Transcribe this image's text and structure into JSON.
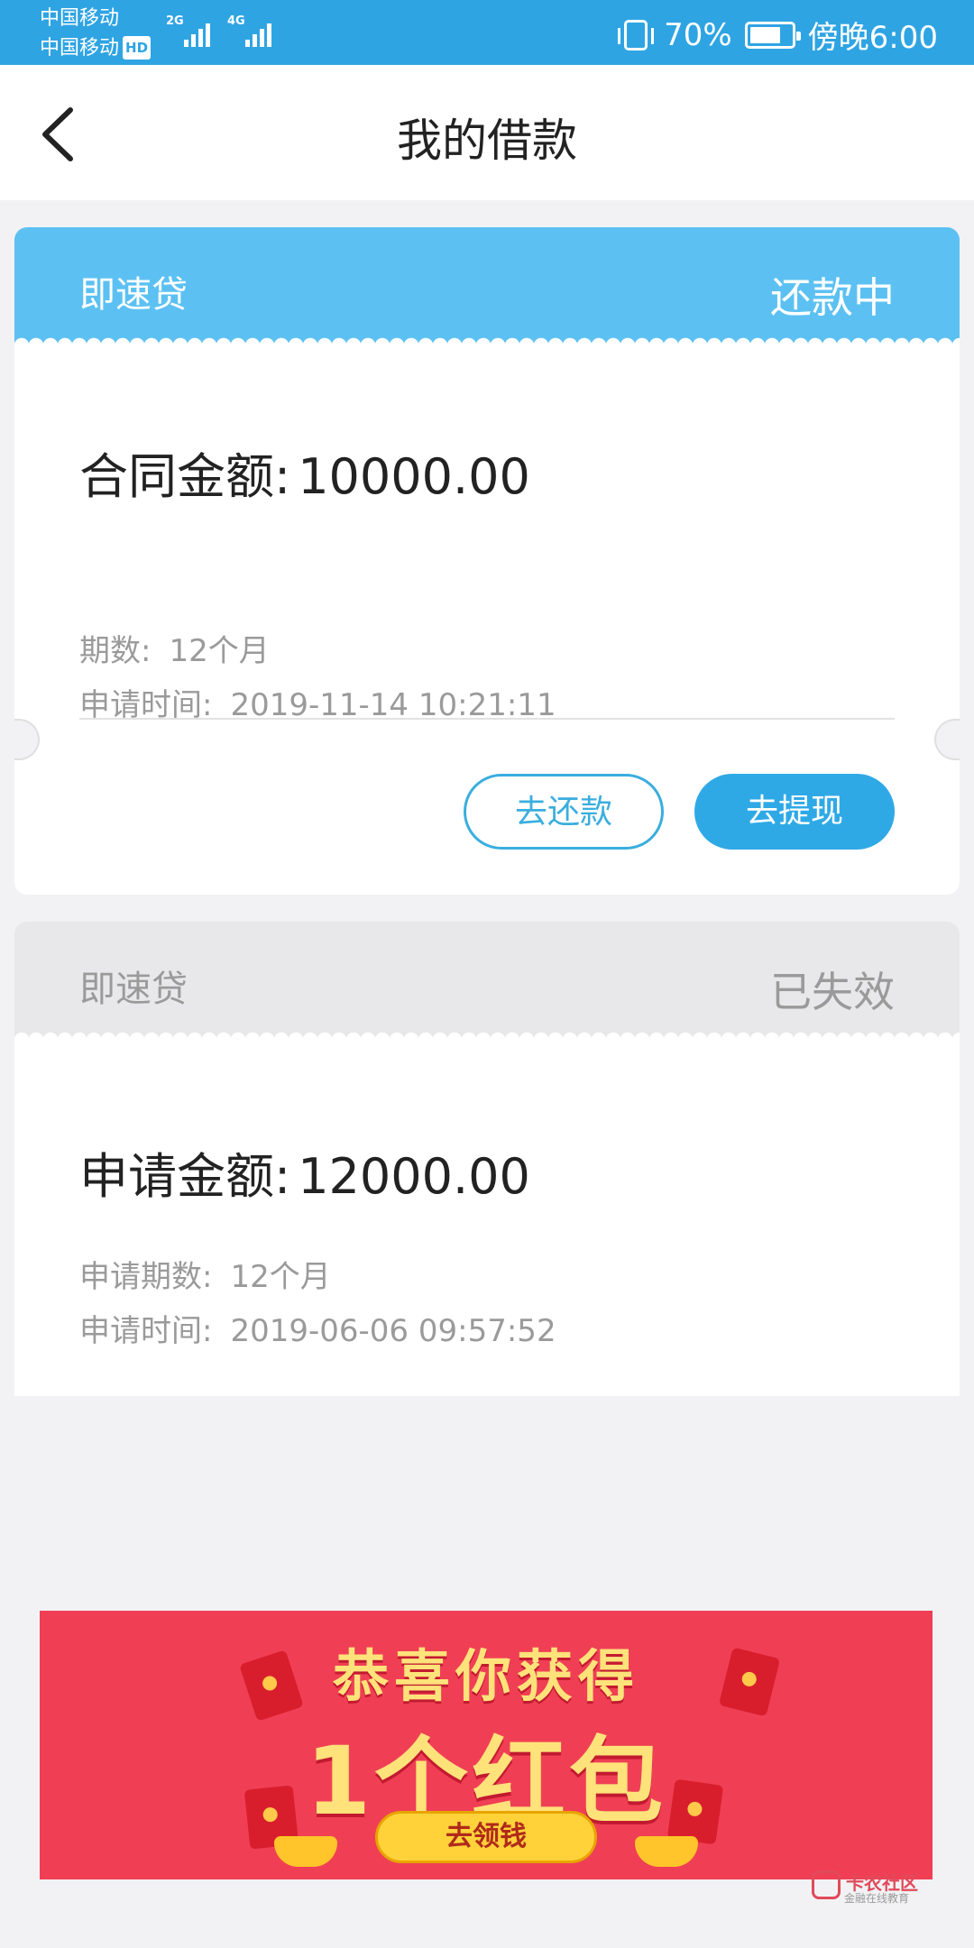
{
  "status_bar": {
    "carrier_1": "中国移动",
    "carrier_2": "中国移动",
    "hd": "HD",
    "net_1": "2G",
    "net_2": "4G",
    "battery": "70%",
    "time": "傍晚6:00"
  },
  "header": {
    "title": "我的借款"
  },
  "loans": [
    {
      "product": "即速贷",
      "status": "还款中",
      "amount_label": "合同金额:",
      "amount": "10000.00",
      "term_label": "期数:",
      "term": "12个月",
      "time_label": "申请时间:",
      "time": "2019-11-14 10:21:11",
      "repay_label": "去还款",
      "withdraw_label": "去提现"
    },
    {
      "product": "即速贷",
      "status": "已失效",
      "amount_label": "申请金额:",
      "amount": "12000.00",
      "term_label": "申请期数:",
      "term": "12个月",
      "time_label": "申请时间:",
      "time": "2019-06-06 09:57:52"
    }
  ],
  "banner": {
    "title": "恭喜你获得",
    "subtitle": "1个红包",
    "button": "去领钱"
  },
  "watermark": {
    "brand": "卡农社区",
    "tagline": "金融在线教育"
  },
  "colors": {
    "status_bar": "#2fa4e3",
    "active_header": "#5cc1f2",
    "inactive_header": "#e8e8ea",
    "primary_button": "#2fa9e6",
    "banner": "#f03f55"
  }
}
